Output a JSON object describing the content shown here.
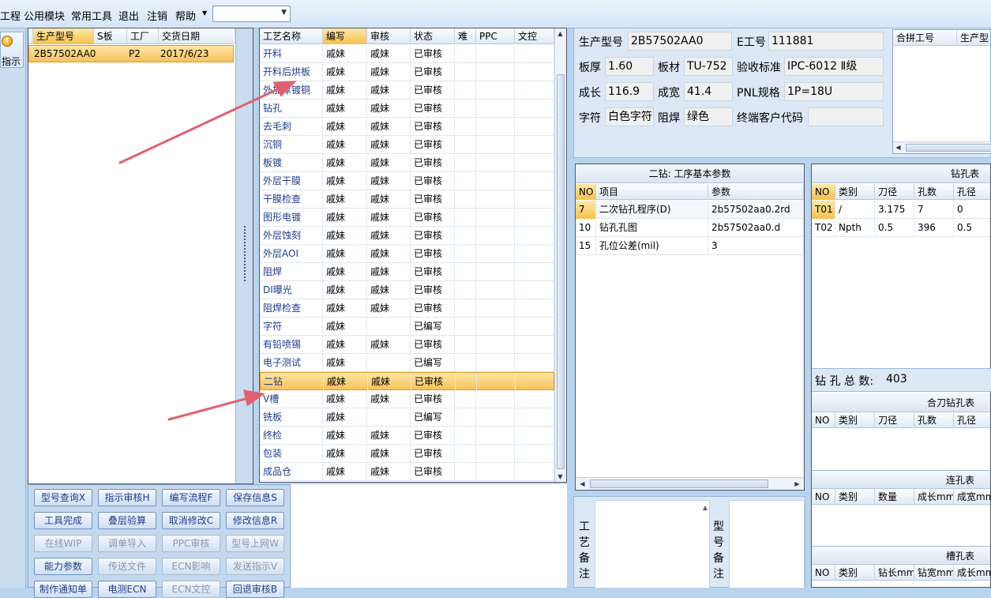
{
  "menu": {
    "items": [
      "工程",
      "公用模块",
      "常用工具",
      "退出",
      "注销",
      "帮助"
    ],
    "combo_value": ""
  },
  "guide_button": {
    "label": "指示"
  },
  "part_grid": {
    "columns": [
      "生产型号",
      "S板",
      "工厂",
      "交货日期"
    ],
    "rows": [
      [
        "2B57502AA0",
        "",
        "P2",
        "2017/6/23"
      ]
    ]
  },
  "process_grid": {
    "columns": [
      "工艺名称",
      "编写",
      "审核",
      "状态",
      "难",
      "PPC",
      "文控"
    ],
    "rows": [
      [
        "开料",
        "戚妹",
        "戚妹",
        "已审核"
      ],
      [
        "开料后烘板",
        "戚妹",
        "戚妹",
        "已审核"
      ],
      [
        "外加厚镀铜",
        "戚妹",
        "戚妹",
        "已审核"
      ],
      [
        "钻孔",
        "戚妹",
        "戚妹",
        "已审核"
      ],
      [
        "去毛刺",
        "戚妹",
        "戚妹",
        "已审核"
      ],
      [
        "沉铜",
        "戚妹",
        "戚妹",
        "已审核"
      ],
      [
        "板镀",
        "戚妹",
        "戚妹",
        "已审核"
      ],
      [
        "外层干膜",
        "戚妹",
        "戚妹",
        "已审核"
      ],
      [
        "干膜检查",
        "戚妹",
        "戚妹",
        "已审核"
      ],
      [
        "图形电镀",
        "戚妹",
        "戚妹",
        "已审核"
      ],
      [
        "外层蚀刻",
        "戚妹",
        "戚妹",
        "已审核"
      ],
      [
        "外层AOI",
        "戚妹",
        "戚妹",
        "已审核"
      ],
      [
        "阻焊",
        "戚妹",
        "戚妹",
        "已审核"
      ],
      [
        "DI曝光",
        "戚妹",
        "戚妹",
        "已审核"
      ],
      [
        "阻焊检查",
        "戚妹",
        "戚妹",
        "已审核"
      ],
      [
        "字符",
        "戚妹",
        "",
        "已编写"
      ],
      [
        "有铅喷锡",
        "戚妹",
        "戚妹",
        "已审核"
      ],
      [
        "电子测试",
        "戚妹",
        "",
        "已编写"
      ],
      [
        "二钻",
        "戚妹",
        "戚妹",
        "已审核"
      ],
      [
        "V槽",
        "戚妹",
        "戚妹",
        "已审核"
      ],
      [
        "铣板",
        "戚妹",
        "",
        "已编写"
      ],
      [
        "终检",
        "戚妹",
        "戚妹",
        "已审核"
      ],
      [
        "包装",
        "戚妹",
        "戚妹",
        "已审核"
      ],
      [
        "成品仓",
        "戚妹",
        "戚妹",
        "已审核"
      ]
    ],
    "selected_index": 18
  },
  "buttons": [
    [
      "型号查询X",
      "指示审核H",
      "编写流程F",
      "保存信息S"
    ],
    [
      "工具完成",
      "叠层验算",
      "取消修改C",
      "修改信息R"
    ],
    [
      "在线WIP",
      "调单导入",
      "PPC审核",
      "型号上网W"
    ],
    [
      "能力参数",
      "传送文件",
      "ECN影响",
      "发送指示V"
    ],
    [
      "制作通知单",
      "电测ECN",
      "ECN文控",
      "回退审核B"
    ]
  ],
  "disabled_buttons": [
    "在线WIP",
    "调单导入",
    "PPC审核",
    "型号上网W",
    "传送文件",
    "ECN影响",
    "发送指示V",
    "ECN文控"
  ],
  "info": {
    "part_no_label": "生产型号",
    "part_no": "2B57502AA0",
    "e_no_label": "E工号",
    "e_no": "111881",
    "thickness_label": "板厚",
    "thickness": "1.60",
    "material_label": "板材",
    "material": "TU-752",
    "standard_label": "验收标准",
    "standard": "IPC-6012 Ⅱ级",
    "length_label": "成长",
    "length": "116.9",
    "width_label": "成宽",
    "width": "41.4",
    "pnl_label": "PNL规格",
    "pnl": "1P=18U",
    "char_label": "字符",
    "char": "白色字符",
    "mask_label": "阻焊",
    "mask": "绿色",
    "customer_label": "终端客户代码",
    "customer": ""
  },
  "merge_grid": {
    "columns": [
      "合拼工号",
      "生产型"
    ]
  },
  "param_grid": {
    "title": "二钻: 工序基本参数",
    "columns": [
      "NO",
      "项目",
      "参数"
    ],
    "rows": [
      [
        "7",
        "二次钻孔程序(D)",
        "2b57502aa0.2rd"
      ],
      [
        "10",
        "钻孔孔图",
        "2b57502aa0.d"
      ],
      [
        "15",
        "孔位公差(mil)",
        "3"
      ]
    ]
  },
  "drill_table": {
    "title": "钻孔表",
    "columns": [
      "NO",
      "类别",
      "刀径",
      "孔数",
      "孔径"
    ],
    "rows": [
      [
        "T01",
        "/",
        "3.175",
        "7",
        "0"
      ],
      [
        "T02",
        "Npth",
        "0.5",
        "396",
        "0.5"
      ]
    ],
    "total_label": "钻 孔 总 数:",
    "total": "403"
  },
  "combined_drill": {
    "title": "合刀钻孔表",
    "columns": [
      "NO",
      "类别",
      "刀径",
      "孔数",
      "孔径"
    ]
  },
  "slot_hole": {
    "title": "连孔表",
    "columns": [
      "NO",
      "类别",
      "数量",
      "成长mm",
      "成宽mm"
    ]
  },
  "slot_table": {
    "title": "槽孔表",
    "columns": [
      "NO",
      "类别",
      "钻长mm",
      "钻宽mm",
      "成长mm"
    ]
  },
  "notes": {
    "process_label": "工艺备注",
    "part_label": "型号备注"
  }
}
